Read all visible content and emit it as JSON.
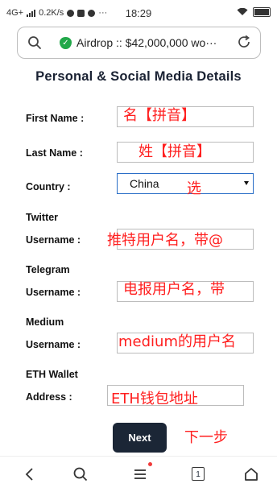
{
  "status_bar": {
    "network": "4G+",
    "speed": "0.2K/s",
    "time": "18:29",
    "more": "···"
  },
  "browser": {
    "url": "Airdrop :: $42,000,000 wo···"
  },
  "form": {
    "title": "Personal & Social Media Details",
    "first_name_label": "First Name :",
    "last_name_label": "Last Name :",
    "country_label": "Country :",
    "country_value": "China",
    "twitter_label_1": "Twitter",
    "twitter_label_2": "Username :",
    "telegram_label_1": "Telegram",
    "telegram_label_2": "Username :",
    "medium_label_1": "Medium",
    "medium_label_2": "Username :",
    "eth_label_1": "ETH Wallet",
    "eth_label_2": "Address :",
    "next_label": "Next"
  },
  "annotations": {
    "first_name": "名【拼音】",
    "last_name": "姓【拼音】",
    "country": "选",
    "twitter": "推特用户名，带@",
    "telegram": "电报用户名，带",
    "medium": "medium的用户名",
    "eth": "ETH钱包地址",
    "next": "下一步"
  },
  "bottom_nav": {
    "tabs_count": "1"
  },
  "colors": {
    "annotation": "#ff1f1f",
    "button": "#1b2636",
    "secure": "#22a84a",
    "focus_border": "#2a6ec7"
  },
  "icons": [
    "search-icon",
    "secure-shield-icon",
    "reload-icon",
    "back-icon",
    "search-nav-icon",
    "menu-icon",
    "tabs-icon",
    "home-icon"
  ]
}
